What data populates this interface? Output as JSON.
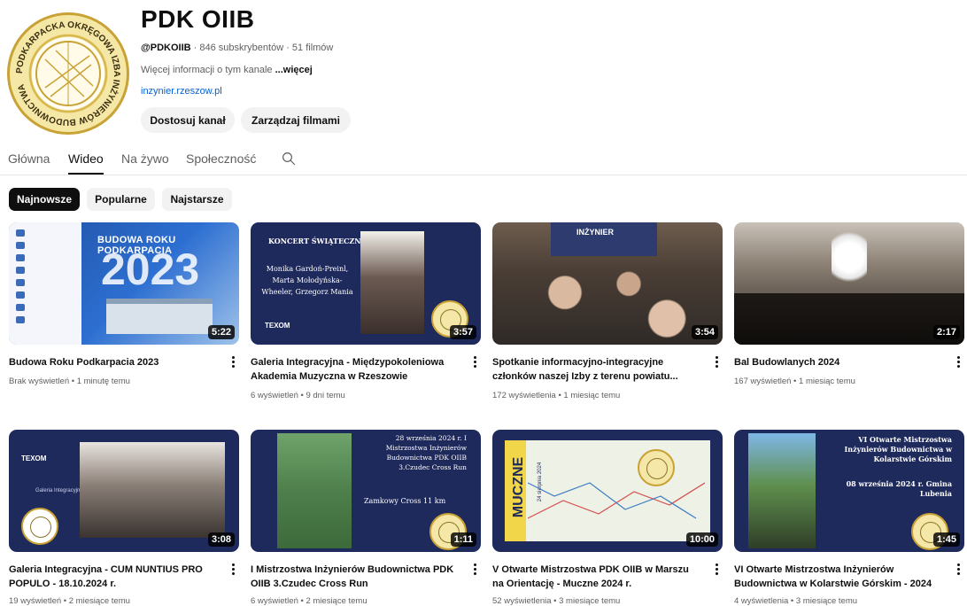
{
  "channel": {
    "name": "PDK OIIB",
    "handle": "@PDKOIIB",
    "meta_rest": " · 846 subskrybentów · 51 filmów",
    "description": "Więcej informacji o tym kanale ",
    "more": "...więcej",
    "link": "inzynier.rzeszow.pl",
    "logo_text": "PODKARPACKA OKRĘGOWA IZBA INŻYNIERÓW BUDOWNICTWA",
    "customize_label": "Dostosuj kanał",
    "manage_label": "Zarządzaj filmami"
  },
  "tabs": [
    "Główna",
    "Wideo",
    "Na żywo",
    "Społeczność"
  ],
  "active_tab": "Wideo",
  "chips": [
    "Najnowsze",
    "Popularne",
    "Najstarsze"
  ],
  "active_chip": "Najnowsze",
  "videos": [
    {
      "title": "Budowa Roku Podkarpacia 2023",
      "meta": "Brak wyświetleń • 1 minutę temu",
      "duration": "5:22",
      "thumb_text": "BUDOWA ROKU PODKARPACIA",
      "thumb_year": "2023"
    },
    {
      "title": "Galeria Integracyjna - Międzypokoleniowa Akademia Muzyczna w Rzeszowie",
      "meta": "6 wyświetleń • 9 dni temu",
      "duration": "3:57",
      "thumb_text": "KONCERT ŚWIĄTECZNY",
      "thumb_sub": "Monika Gardoń-Preinl, Marta Mołodyńska-Wheeler, Grzegorz Mania",
      "thumb_brand": "TEXOM"
    },
    {
      "title": "Spotkanie informacyjno-integracyjne członków naszej Izby z terenu powiatu...",
      "meta": "172 wyświetlenia • 1 miesiąc temu",
      "duration": "3:54",
      "thumb_text": "INŻYNIER"
    },
    {
      "title": "Bal Budowlanych 2024",
      "meta": "167 wyświetleń • 1 miesiąc temu",
      "duration": "2:17"
    },
    {
      "title": "Galeria Integracyjna - CUM NUNTIUS PRO POPULO - 18.10.2024 r.",
      "meta": "19 wyświetleń • 2 miesiące temu",
      "duration": "3:08",
      "thumb_brand": "TEXOM",
      "thumb_sub": "Galeria Integracyjna"
    },
    {
      "title": "I Mistrzostwa Inżynierów Budownictwa PDK OIIB 3.Czudec Cross Run",
      "meta": "6 wyświetleń • 2 miesiące temu",
      "duration": "1:11",
      "thumb_text": "28 września 2024 r. I Mistrzostwa Inżynierów Budownictwa PDK OIIB 3.Czudec Cross Run",
      "thumb_sub": "Zamkowy Cross 11 km"
    },
    {
      "title": "V Otwarte Mistrzostwa PDK OIIB w Marszu na Orientację - Muczne 2024 r.",
      "meta": "52 wyświetlenia • 3 miesiące temu",
      "duration": "10:00",
      "thumb_text": "MUCZNE",
      "thumb_sub": "24 sierpnia 2024"
    },
    {
      "title": "VI Otwarte Mistrzostwa Inżynierów Budownictwa w Kolarstwie Górskim - 2024",
      "meta": "4 wyświetlenia • 3 miesiące temu",
      "duration": "1:45",
      "thumb_text": "VI Otwarte Mistrzostwa Inżynierów Budownictwa w Kolarstwie Górskim",
      "thumb_sub": "08 września 2024 r. Gmina Lubenia"
    }
  ],
  "colors": {
    "progress": "#ff0033",
    "link": "#065fd4",
    "chip_active": "#0f0f0f",
    "navy": "#1f2a5c",
    "gold": "#c9a236"
  },
  "icons": [
    "search-icon",
    "more-vert-icon",
    "channel-logo-icon"
  ]
}
